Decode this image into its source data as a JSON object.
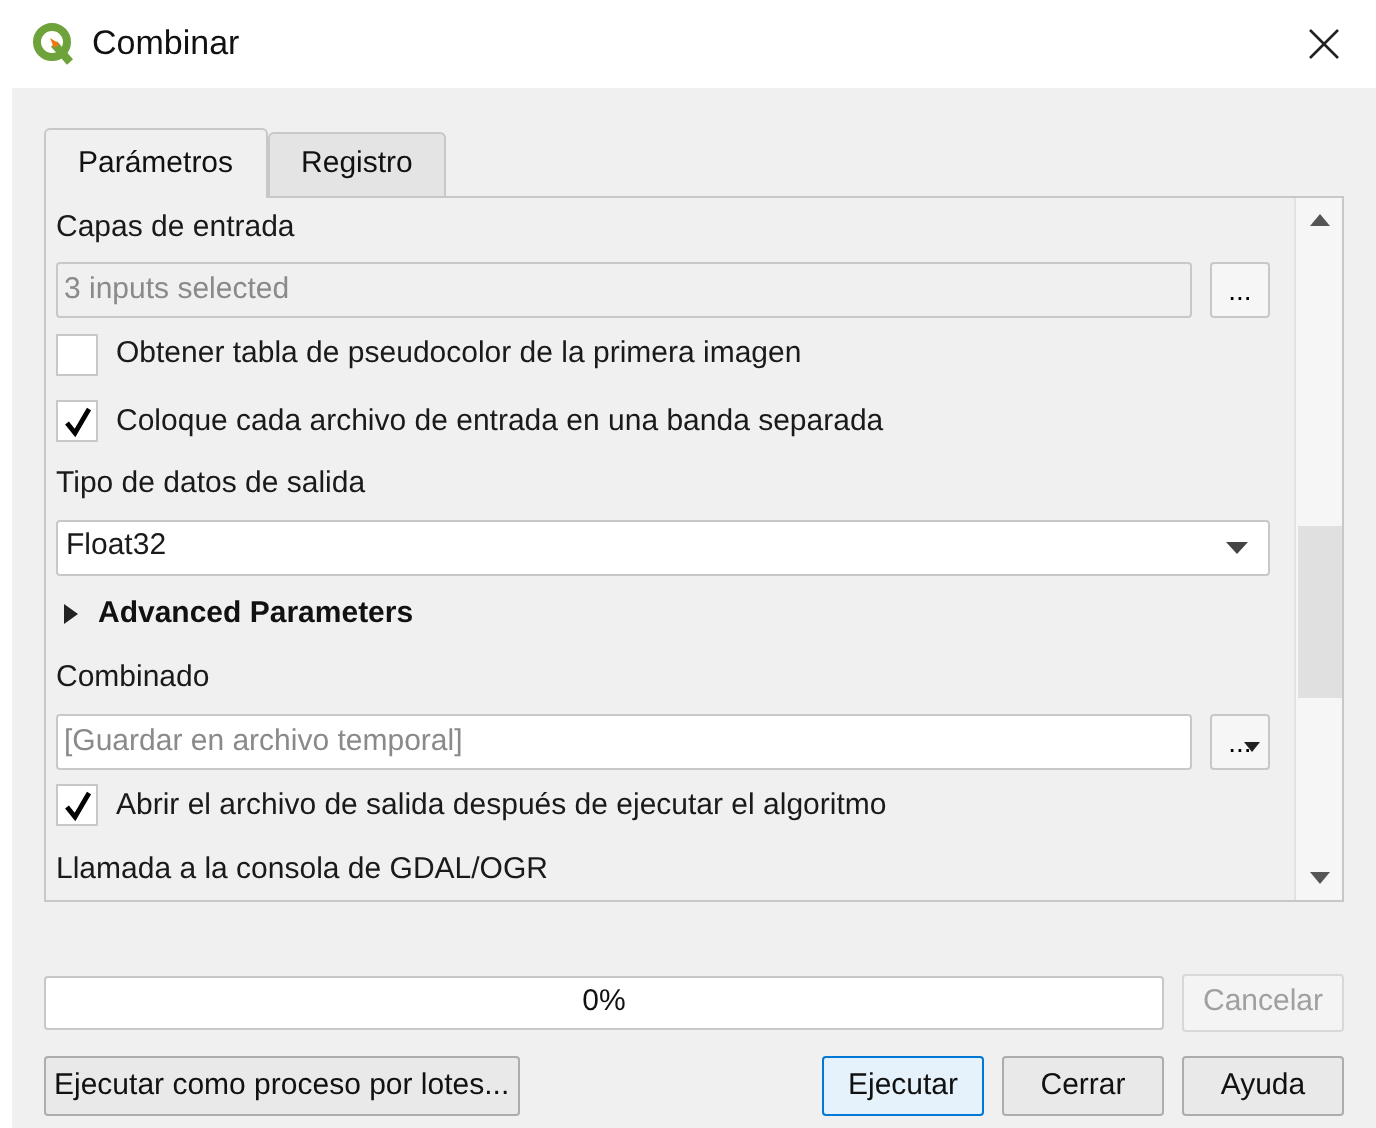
{
  "window": {
    "title": "Combinar"
  },
  "tabs": [
    {
      "label": "Parámetros",
      "selected": true
    },
    {
      "label": "Registro",
      "selected": false
    }
  ],
  "parameters": [
    {
      "kind": "label",
      "text": "Capas de entrada"
    },
    {
      "kind": "field",
      "value": "3 inputs selected",
      "disabled": true,
      "button": "...",
      "menu": false
    },
    {
      "kind": "checkbox",
      "label": "Obtener tabla de pseudocolor de la primera imagen",
      "checked": false
    },
    {
      "kind": "checkbox",
      "label": "Coloque cada archivo de entrada en una banda separada",
      "checked": true
    },
    {
      "kind": "label",
      "text": "Tipo de datos de salida"
    },
    {
      "kind": "combo",
      "value": "Float32"
    },
    {
      "kind": "group",
      "label": "Advanced Parameters",
      "expanded": false
    },
    {
      "kind": "label",
      "text": "Combinado"
    },
    {
      "kind": "field",
      "placeholder": "[Guardar en archivo temporal]",
      "disabled": false,
      "button": "...",
      "menu": true
    },
    {
      "kind": "checkbox",
      "label": "Abrir el archivo de salida después de ejecutar el algoritmo",
      "checked": true
    },
    {
      "kind": "label",
      "text": "Llamada a la consola de GDAL/OGR"
    }
  ],
  "progress": {
    "level": 0,
    "text": "0%"
  },
  "cancel_button": {
    "label": "Cancelar",
    "disabled": true
  },
  "batch_button": {
    "label": "Ejecutar como proceso por lotes..."
  },
  "buttons": [
    {
      "label": "Ejecutar",
      "default": true
    },
    {
      "label": "Cerrar",
      "default": false
    },
    {
      "label": "Ayuda",
      "default": false
    }
  ]
}
